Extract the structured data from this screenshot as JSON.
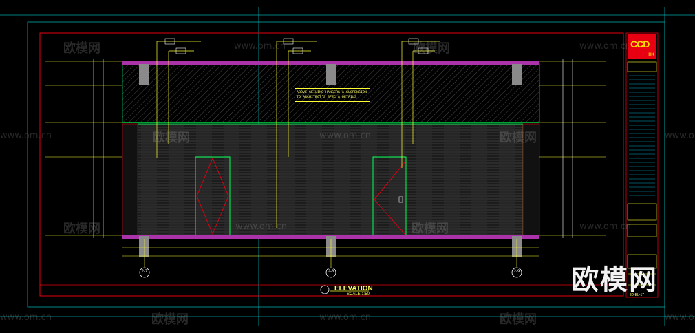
{
  "drawing": {
    "title": "ELEVATION",
    "scale": "SCALE 1:50",
    "note_lines": [
      "ABOVE CEILING HANGERS & SUSPENSION",
      "TO ARCHITECT'S SPEC & DETAILS"
    ],
    "grid_labels": [
      "2-7",
      "2-8",
      "2-9"
    ],
    "drawing_number": "ID-EL-17"
  },
  "titleblock": {
    "logo": "CCD",
    "logo_sub": "HK"
  },
  "watermark": {
    "brand": "欧模网",
    "url": "www.om.cn"
  },
  "colors": {
    "background": "#000000",
    "frame_red": "#e60012",
    "guide_cyan": "#00c8c8",
    "dim_yellow": "#ffff33",
    "green": "#00ff55",
    "magenta": "#cc44cc",
    "panel_fill": "#2a2a2a"
  }
}
